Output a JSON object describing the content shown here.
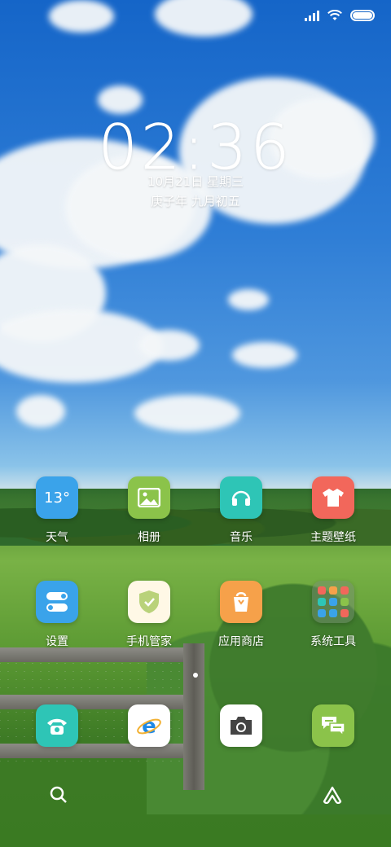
{
  "status_bar": {
    "icons": [
      "signal-icon",
      "wifi-icon",
      "battery-icon"
    ]
  },
  "lock": {
    "time": "02:36",
    "date": "10月21日 星期三",
    "lunar_date": "庚子年 九月初五"
  },
  "apps_row1": [
    {
      "name": "天气",
      "icon": "weather-icon",
      "icon_text": "13°",
      "color": "#3aa3ea"
    },
    {
      "name": "相册",
      "icon": "gallery-icon",
      "color": "#8bc34a"
    },
    {
      "name": "音乐",
      "icon": "music-icon",
      "color": "#2ec5b6"
    },
    {
      "name": "主题壁纸",
      "icon": "themes-icon",
      "color": "#f2675b"
    }
  ],
  "apps_row2": [
    {
      "name": "设置",
      "icon": "settings-icon",
      "color": "#3aa3ea"
    },
    {
      "name": "手机管家",
      "icon": "security-icon",
      "color": "#fff8e6"
    },
    {
      "name": "应用商店",
      "icon": "app-store-icon",
      "color": "#f6a14a"
    },
    {
      "name": "系统工具",
      "icon": "folder-icon"
    }
  ],
  "dock": [
    {
      "icon": "phone-icon",
      "color": "#2ec5b6"
    },
    {
      "icon": "browser-icon",
      "color": "#ffffff"
    },
    {
      "icon": "camera-icon",
      "color": "#ffffff"
    },
    {
      "icon": "messages-icon",
      "color": "#8bc34a"
    }
  ],
  "bottom": {
    "left_icon": "search-icon",
    "right_icon": "assistant-icon"
  }
}
